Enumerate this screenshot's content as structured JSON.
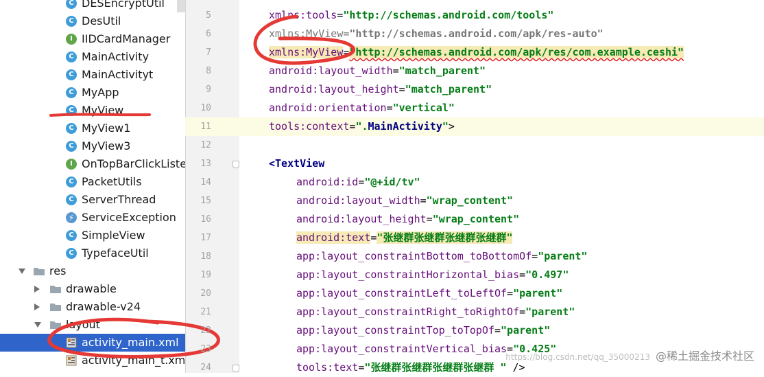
{
  "project_tree": {
    "items": [
      {
        "label": "DESEncryptUtil",
        "icon": "class-icon"
      },
      {
        "label": "DesUtil",
        "icon": "class-icon"
      },
      {
        "label": "IIDCardManager",
        "icon": "interface-icon"
      },
      {
        "label": "MainActivity",
        "icon": "class-icon"
      },
      {
        "label": "MainActivityt",
        "icon": "class-icon"
      },
      {
        "label": "MyApp",
        "icon": "class-icon"
      },
      {
        "label": "MyView",
        "icon": "class-icon"
      },
      {
        "label": "MyView1",
        "icon": "class-icon"
      },
      {
        "label": "MyView3",
        "icon": "class-icon"
      },
      {
        "label": "OnTopBarClickListener",
        "icon": "interface-icon"
      },
      {
        "label": "PacketUtils",
        "icon": "class-icon"
      },
      {
        "label": "ServerThread",
        "icon": "class-icon"
      },
      {
        "label": "ServiceException",
        "icon": "exception-icon"
      },
      {
        "label": "SimpleView",
        "icon": "class-icon"
      },
      {
        "label": "TypefaceUtil",
        "icon": "class-icon"
      }
    ],
    "res": {
      "label": "res",
      "drawable": "drawable",
      "drawable_v24": "drawable-v24",
      "layout": "layout",
      "selected_file": "activity_main.xml",
      "next_file": "activity_main_t.xml"
    }
  },
  "editor": {
    "line_numbers": [
      "5",
      "6",
      "7",
      "8",
      "9",
      "10",
      "11",
      "12",
      "13",
      "14",
      "15",
      "16",
      "17",
      "18",
      "19",
      "20",
      "21",
      "22",
      "23",
      "24"
    ],
    "lines": {
      "l5": {
        "attr": "xmlns:tools",
        "value": "\"http://schemas.android.com/tools\""
      },
      "l6": {
        "attr": "xmlns:MyView",
        "value": "\"http://schemas.android.com/apk/res-auto\""
      },
      "l7": {
        "attr": "xmlns:MyView",
        "value": "\"http://schemas.android.com/apk/res/com.example.ceshi\""
      },
      "l8": {
        "attr": "android:layout_width",
        "value": "\"match_parent\""
      },
      "l9": {
        "attr": "android:layout_height",
        "value": "\"match_parent\""
      },
      "l10": {
        "attr": "android:orientation",
        "value": "\"vertical\""
      },
      "l11": {
        "attr": "tools:context",
        "value_pre": "\".",
        "value_cls": "MainActivity",
        "value_post": "\"",
        "close": ">"
      },
      "l13": {
        "tag": "<TextView"
      },
      "l14": {
        "attr": "android:id",
        "value": "\"@+id/tv\""
      },
      "l15": {
        "attr": "android:layout_width",
        "value": "\"wrap_content\""
      },
      "l16": {
        "attr": "android:layout_height",
        "value": "\"wrap_content\""
      },
      "l17": {
        "attr": "android:text",
        "value": "\"张继群张继群张继群张继群\""
      },
      "l18": {
        "attr": "app:layout_constraintBottom_toBottomOf",
        "value": "\"parent\""
      },
      "l19": {
        "attr": "app:layout_constraintHorizontal_bias",
        "value": "\"0.497\""
      },
      "l20": {
        "attr": "app:layout_constraintLeft_toLeftOf",
        "value": "\"parent\""
      },
      "l21": {
        "attr": "app:layout_constraintRight_toRightOf",
        "value": "\"parent\""
      },
      "l22": {
        "attr": "app:layout_constraintTop_toTopOf",
        "value": "\"parent\""
      },
      "l23": {
        "attr": "app:layout_constraintVertical_bias",
        "value": "\"0.425\""
      },
      "l24": {
        "attr": "tools:text",
        "value": "\"张继群张继群张继群张继群 \"",
        "close": " />"
      }
    },
    "eq": "="
  },
  "watermark": {
    "url": "https://blog.csdn.net/qq_35000213",
    "text": "@稀土掘金技术社区"
  },
  "colors": {
    "selection": "#2f65ca",
    "annotation": "#e53935",
    "current_line": "#fcfbe3"
  }
}
